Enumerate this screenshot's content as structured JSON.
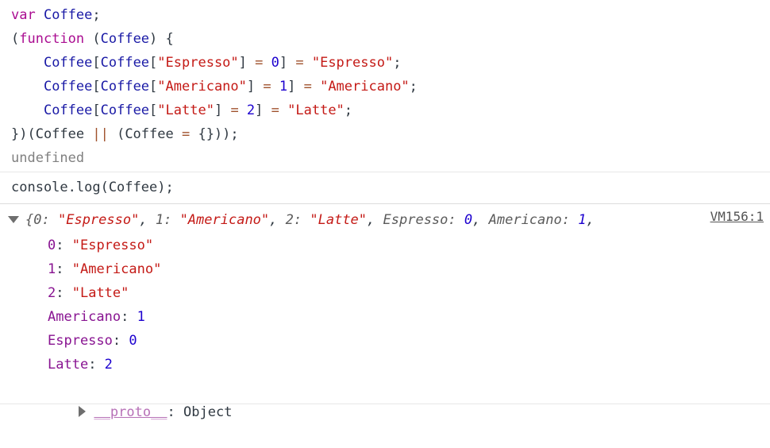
{
  "app": {
    "name": "devtools-console",
    "vm_link": "VM156:1"
  },
  "code_lines": [
    {
      "id": "line-1",
      "tokens": [
        {
          "t": "var",
          "c": "keyword"
        },
        {
          "t": " ",
          "c": "plain"
        },
        {
          "t": "Coffee",
          "c": "ident"
        },
        {
          "t": ";",
          "c": "punc"
        }
      ]
    },
    {
      "id": "line-2",
      "tokens": [
        {
          "t": "(",
          "c": "punc"
        },
        {
          "t": "function",
          "c": "keyword"
        },
        {
          "t": " (",
          "c": "punc"
        },
        {
          "t": "Coffee",
          "c": "ident"
        },
        {
          "t": ") {",
          "c": "punc"
        }
      ]
    },
    {
      "id": "line-3",
      "tokens": [
        {
          "t": "    ",
          "c": "plain"
        },
        {
          "t": "Coffee",
          "c": "ident"
        },
        {
          "t": "[",
          "c": "punc"
        },
        {
          "t": "Coffee",
          "c": "ident"
        },
        {
          "t": "[",
          "c": "punc"
        },
        {
          "t": "\"Espresso\"",
          "c": "string"
        },
        {
          "t": "]",
          "c": "punc"
        },
        {
          "t": " = ",
          "c": "op"
        },
        {
          "t": "0",
          "c": "number"
        },
        {
          "t": "]",
          "c": "punc"
        },
        {
          "t": " = ",
          "c": "op"
        },
        {
          "t": "\"Espresso\"",
          "c": "string"
        },
        {
          "t": ";",
          "c": "punc"
        }
      ]
    },
    {
      "id": "line-4",
      "tokens": [
        {
          "t": "    ",
          "c": "plain"
        },
        {
          "t": "Coffee",
          "c": "ident"
        },
        {
          "t": "[",
          "c": "punc"
        },
        {
          "t": "Coffee",
          "c": "ident"
        },
        {
          "t": "[",
          "c": "punc"
        },
        {
          "t": "\"Americano\"",
          "c": "string"
        },
        {
          "t": "]",
          "c": "punc"
        },
        {
          "t": " = ",
          "c": "op"
        },
        {
          "t": "1",
          "c": "number"
        },
        {
          "t": "]",
          "c": "punc"
        },
        {
          "t": " = ",
          "c": "op"
        },
        {
          "t": "\"Americano\"",
          "c": "string"
        },
        {
          "t": ";",
          "c": "punc"
        }
      ]
    },
    {
      "id": "line-5",
      "tokens": [
        {
          "t": "    ",
          "c": "plain"
        },
        {
          "t": "Coffee",
          "c": "ident"
        },
        {
          "t": "[",
          "c": "punc"
        },
        {
          "t": "Coffee",
          "c": "ident"
        },
        {
          "t": "[",
          "c": "punc"
        },
        {
          "t": "\"Latte\"",
          "c": "string"
        },
        {
          "t": "]",
          "c": "punc"
        },
        {
          "t": " = ",
          "c": "op"
        },
        {
          "t": "2",
          "c": "number"
        },
        {
          "t": "]",
          "c": "punc"
        },
        {
          "t": " = ",
          "c": "op"
        },
        {
          "t": "\"Latte\"",
          "c": "string"
        },
        {
          "t": ";",
          "c": "punc"
        }
      ]
    },
    {
      "id": "line-6",
      "tokens": [
        {
          "t": "})(Coffee ",
          "c": "punc"
        },
        {
          "t": "||",
          "c": "op"
        },
        {
          "t": " (Coffee ",
          "c": "punc"
        },
        {
          "t": "=",
          "c": "op"
        },
        {
          "t": " {}));",
          "c": "punc"
        }
      ]
    },
    {
      "id": "line-7-undefined",
      "tokens": [
        {
          "t": "undefined",
          "c": "undef"
        }
      ]
    }
  ],
  "input_echo": {
    "text": "console.log(Coffee);"
  },
  "result": {
    "expanded": true,
    "disclosure_icon": "triangle-down-icon",
    "preview_tokens": [
      {
        "t": "{",
        "c": "brace"
      },
      {
        "t": "0",
        "c": "key-prev"
      },
      {
        "t": ": ",
        "c": "key-prev"
      },
      {
        "t": "\"Espresso\"",
        "c": "string"
      },
      {
        "t": ", ",
        "c": "comma"
      },
      {
        "t": "1",
        "c": "key-prev"
      },
      {
        "t": ": ",
        "c": "key-prev"
      },
      {
        "t": "\"Americano\"",
        "c": "string"
      },
      {
        "t": ", ",
        "c": "comma"
      },
      {
        "t": "2",
        "c": "key-prev"
      },
      {
        "t": ": ",
        "c": "key-prev"
      },
      {
        "t": "\"Latte\"",
        "c": "string"
      },
      {
        "t": ", ",
        "c": "comma"
      },
      {
        "t": "Espresso",
        "c": "key-prev"
      },
      {
        "t": ": ",
        "c": "key-prev"
      },
      {
        "t": "0",
        "c": "number"
      },
      {
        "t": ", ",
        "c": "comma"
      },
      {
        "t": "Americano",
        "c": "key-prev"
      },
      {
        "t": ": ",
        "c": "key-prev"
      },
      {
        "t": "1",
        "c": "number"
      },
      {
        "t": ",",
        "c": "comma"
      }
    ],
    "properties": [
      {
        "name": "0",
        "value": "\"Espresso\"",
        "kind": "string"
      },
      {
        "name": "1",
        "value": "\"Americano\"",
        "kind": "string"
      },
      {
        "name": "2",
        "value": "\"Latte\"",
        "kind": "string"
      },
      {
        "name": "Americano",
        "value": "1",
        "kind": "number"
      },
      {
        "name": "Espresso",
        "value": "0",
        "kind": "number"
      },
      {
        "name": "Latte",
        "value": "2",
        "kind": "number"
      }
    ],
    "proto": {
      "disclosure_icon": "triangle-right-icon",
      "name": "__proto__",
      "separator": ": ",
      "value": "Object"
    }
  },
  "colors": {
    "keyword": "#aa0d91",
    "identifier": "#1a1aa6",
    "string": "#c41a16",
    "number": "#1c00cf",
    "operator": "#a0522d",
    "property_name": "#881391",
    "proto_name": "#b771b7",
    "undefined": "#808080",
    "link": "#545454",
    "background": "#ffffff"
  }
}
